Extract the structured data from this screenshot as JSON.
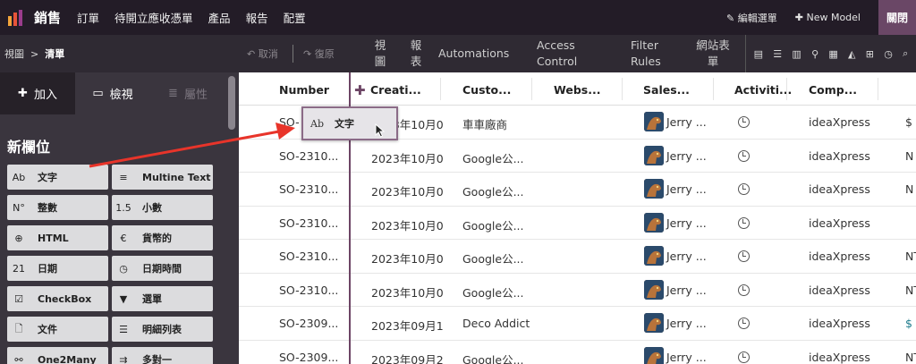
{
  "topnav": {
    "app_name": "銷售",
    "menu": [
      "訂單",
      "待開立應收憑單",
      "產品",
      "報告",
      "配置"
    ],
    "edit_menu": "編輯選單",
    "new_model": "New Model",
    "close": "關閉"
  },
  "controlbar": {
    "breadcrumb_root": "視圖",
    "breadcrumb_sep": ">",
    "breadcrumb_current": "清單",
    "undo": "取消",
    "redo": "復原",
    "views_label": "視\n圖",
    "reports_label": "報\n表",
    "automations": "Automations",
    "access_control": "Access\nControl",
    "filter_rules": "Filter\nRules",
    "website_form": "網站表\n單"
  },
  "sidebar": {
    "tabs": [
      {
        "icon": "plus-icon",
        "label": "加入"
      },
      {
        "icon": "monitor-icon",
        "label": "檢視"
      },
      {
        "icon": "list-icon",
        "label": "屬性"
      }
    ],
    "section_title": "新欄位",
    "fields": [
      {
        "icon": "Ab",
        "label": "文字"
      },
      {
        "icon": "≡",
        "label": "Multine Text"
      },
      {
        "icon": "N°",
        "label": "整數"
      },
      {
        "icon": "1.5",
        "label": "小數"
      },
      {
        "icon": "⊕",
        "label": "HTML"
      },
      {
        "icon": "€",
        "label": "貨幣的"
      },
      {
        "icon": "21",
        "label": "日期"
      },
      {
        "icon": "◷",
        "label": "日期時間"
      },
      {
        "icon": "☑",
        "label": "CheckBox"
      },
      {
        "icon": "▼",
        "label": "選單"
      },
      {
        "icon": "🗋",
        "label": "文件"
      },
      {
        "icon": "☰",
        "label": "明細列表"
      },
      {
        "icon": "⚯",
        "label": "One2Many"
      },
      {
        "icon": "⇉",
        "label": "多對一"
      }
    ]
  },
  "table": {
    "columns": [
      "Number",
      "Creati...",
      "Custo...",
      "Webs...",
      "Sales...",
      "Activiti...",
      "Comp..."
    ],
    "rows": [
      {
        "number": "SO-",
        "date": "2023年10月0",
        "customer": "車車廠商",
        "sales": "Jerry ...",
        "company": "ideaXpress",
        "amount": "$"
      },
      {
        "number": "SO-2310...",
        "date": "2023年10月0",
        "customer": "Google公...",
        "sales": "Jerry ...",
        "company": "ideaXpress",
        "amount": "N"
      },
      {
        "number": "SO-2310...",
        "date": "2023年10月0",
        "customer": "Google公...",
        "sales": "Jerry ...",
        "company": "ideaXpress",
        "amount": "N"
      },
      {
        "number": "SO-2310...",
        "date": "2023年10月0",
        "customer": "Google公...",
        "sales": "Jerry ...",
        "company": "ideaXpress",
        "amount": ""
      },
      {
        "number": "SO-2310...",
        "date": "2023年10月0",
        "customer": "Google公...",
        "sales": "Jerry ...",
        "company": "ideaXpress",
        "amount": "NT"
      },
      {
        "number": "SO-2310...",
        "date": "2023年10月0",
        "customer": "Google公...",
        "sales": "Jerry ...",
        "company": "ideaXpress",
        "amount": "NT"
      },
      {
        "number": "SO-2309...",
        "date": "2023年09月1",
        "customer": "Deco Addict",
        "sales": "Jerry ...",
        "company": "ideaXpress",
        "amount": "$"
      },
      {
        "number": "SO-2309...",
        "date": "2023年09月2",
        "customer": "Google公...",
        "sales": "Jerry ...",
        "company": "ideaXpress",
        "amount": "NT"
      }
    ]
  },
  "drag_ghost": {
    "icon": "Ab",
    "label": "文字"
  },
  "colors": {
    "topnav": "#231c27",
    "controlbar": "#2f2a33",
    "sidebar": "#3a353e",
    "accent": "#6d4565",
    "arrow": "#e8342a"
  }
}
